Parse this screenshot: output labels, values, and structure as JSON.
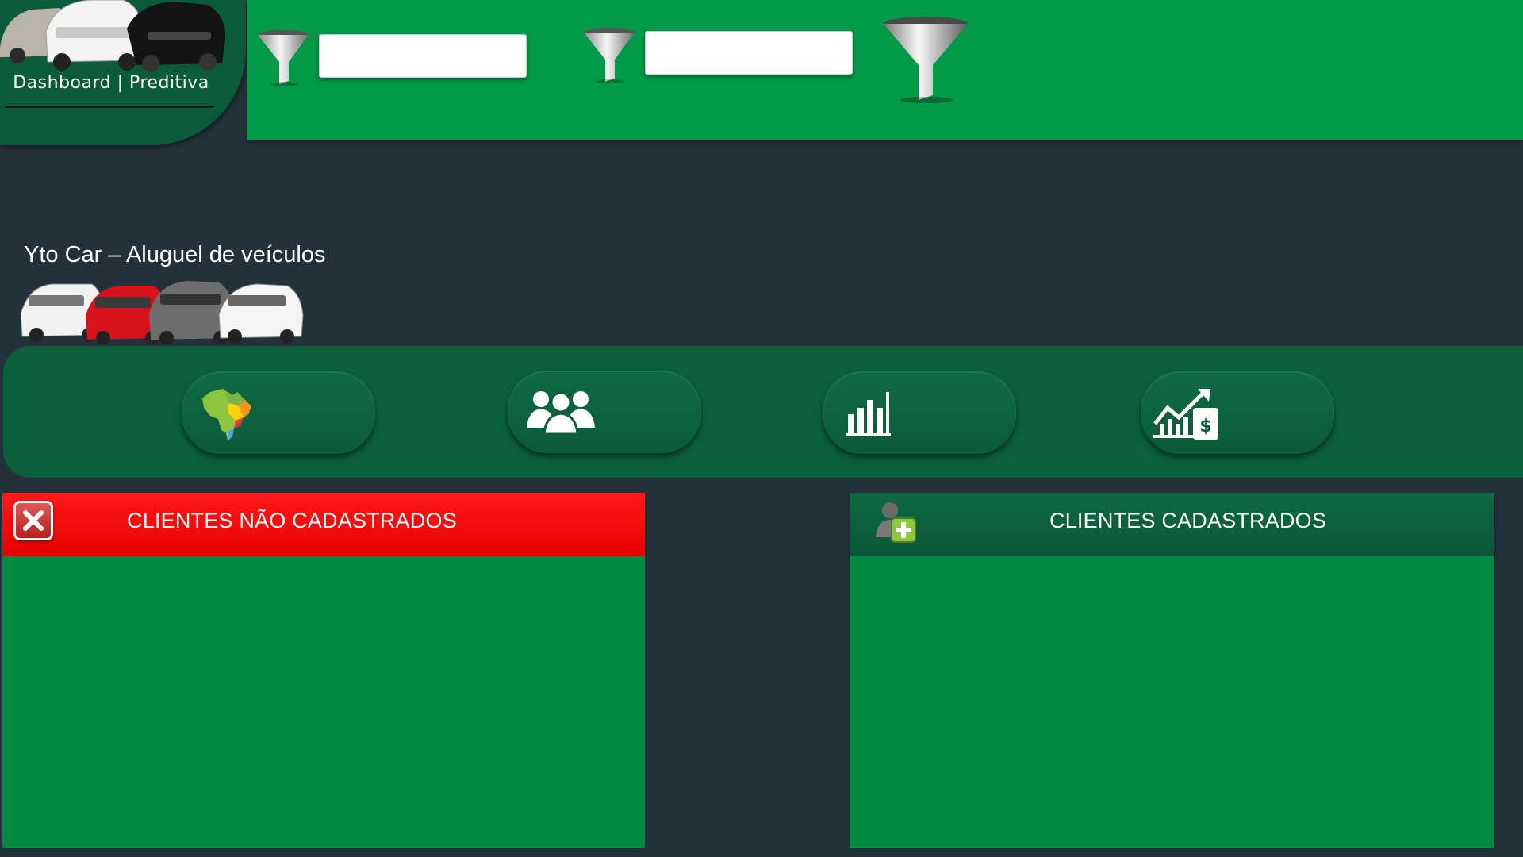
{
  "logo": {
    "caption": "Dashboard | Preditiva",
    "icon": "car-fleet-image"
  },
  "filters": {
    "filter1": {
      "icon": "funnel-icon",
      "value": ""
    },
    "filter2": {
      "icon": "funnel-icon",
      "value": ""
    },
    "clear_filter": {
      "icon": "funnel-large-icon"
    }
  },
  "header": {
    "title": "Yto Car – Aluguel de veículos",
    "cars_icon": "car-lineup-image"
  },
  "nav": {
    "buttons": [
      {
        "icon": "brazil-map-icon"
      },
      {
        "icon": "customers-group-icon"
      },
      {
        "icon": "bar-chart-icon"
      },
      {
        "icon": "revenue-growth-icon"
      }
    ]
  },
  "panels": {
    "unregistered": {
      "title": "CLIENTES NÃO CADASTRADOS",
      "icon": "close-icon",
      "header_color": "#ff0000"
    },
    "registered": {
      "title": "CLIENTES CADASTRADOS",
      "icon": "add-user-icon",
      "header_color": "#0b5f3c"
    }
  },
  "colors": {
    "background": "#23323a",
    "filter_bar": "#019a48",
    "nav_strip": "#0b5f3c",
    "panel_body": "#038a42",
    "alert_red": "#ff0000"
  }
}
